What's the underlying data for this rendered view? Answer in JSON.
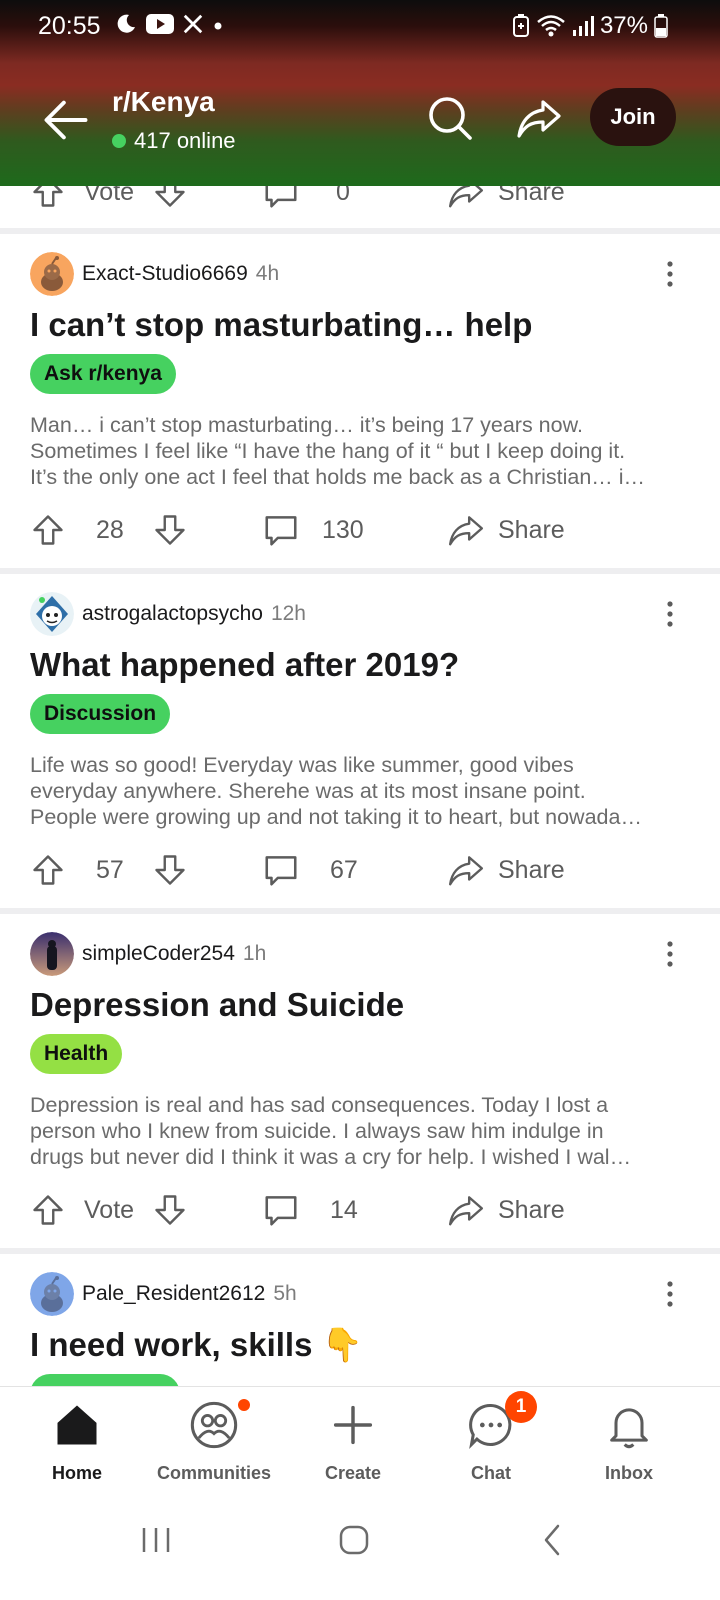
{
  "status_bar": {
    "time": "20:55",
    "battery": "37%",
    "left_icons": [
      "moon-icon",
      "youtube-icon",
      "x-icon",
      "dot-icon"
    ],
    "right_icons": [
      "battery-saver-icon",
      "wifi-icon",
      "signal-icon",
      "battery-icon"
    ]
  },
  "header": {
    "subreddit": "r/Kenya",
    "online": "417 online",
    "join_label": "Join"
  },
  "top_partial_actions": {
    "vote_label": "Vote",
    "comments": "0",
    "share_label": "Share"
  },
  "posts": [
    {
      "author": "Exact-Studio6669",
      "age": "4h",
      "title": "I can’t stop masturbating… help",
      "flair": "Ask r/kenya",
      "flair_color": "#46d160",
      "body": [
        "Man… i can’t stop masturbating… it’s being 17 years now.",
        "Sometimes I feel like “I have the hang of it “ but I keep doing it.",
        "It’s the only one act I feel that holds me back as a Christian… i…"
      ],
      "votes": "28",
      "comments": "130",
      "share_label": "Share"
    },
    {
      "author": "astrogalactopsycho",
      "age": "12h",
      "title": "What happened after 2019?",
      "flair": "Discussion",
      "flair_color": "#46d160",
      "body": [
        "Life was so good! Everyday was like summer, good vibes",
        "everyday anywhere. Sherehe was at its most insane point.",
        "People were growing up and not taking it to heart, but nowada…"
      ],
      "votes": "57",
      "comments": "67",
      "share_label": "Share"
    },
    {
      "author": "simpleCoder254",
      "age": "1h",
      "title": "Depression and Suicide",
      "flair": "Health",
      "flair_color": "#94e044",
      "body": [
        "Depression is real and has sad consequences. Today I lost a",
        "person who I knew from suicide.  I always saw him indulge in",
        "drugs but never did I think it was a cry for help.  I wished I wal…"
      ],
      "votes": "Vote",
      "comments": "14",
      "share_label": "Share"
    },
    {
      "author": "Pale_Resident2612",
      "age": "5h",
      "title": "I need work, skills 👇"
    }
  ],
  "bottom_nav": [
    {
      "label": "Home",
      "icon": "home-icon",
      "active": true
    },
    {
      "label": "Communities",
      "icon": "communities-icon",
      "active": false
    },
    {
      "label": "Create",
      "icon": "plus-icon",
      "active": false
    },
    {
      "label": "Chat",
      "icon": "chat-icon",
      "active": false,
      "badge": "1"
    },
    {
      "label": "Inbox",
      "icon": "bell-icon",
      "active": false
    }
  ],
  "colors": {
    "accent": "#ff4500",
    "online": "#46d160",
    "join_bg": "#2a120f"
  }
}
